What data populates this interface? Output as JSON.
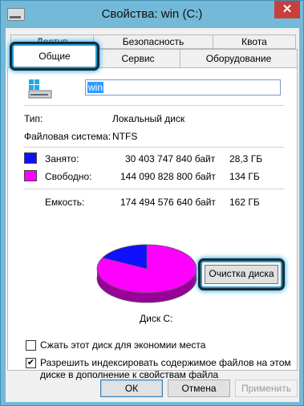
{
  "window": {
    "title": "Свойства: win (C:)",
    "close_symbol": "✕"
  },
  "tabs": {
    "row1": [
      "Доступ",
      "Безопасность",
      "Квота"
    ],
    "row2": [
      "Общие",
      "Сервис",
      "Оборудование"
    ]
  },
  "general": {
    "drive_name": "win",
    "type_label": "Тип:",
    "type_value": "Локальный диск",
    "fs_label": "Файловая система:",
    "fs_value": "NTFS",
    "used": {
      "label": "Занято:",
      "bytes": "30 403 747 840 байт",
      "size": "28,3 ГБ",
      "color": "#1010ff"
    },
    "free": {
      "label": "Свободно:",
      "bytes": "144 090 828 800 байт",
      "size": "134 ГБ",
      "color": "#ff00ff"
    },
    "capacity": {
      "label": "Емкость:",
      "bytes": "174 494 576 640 байт",
      "size": "162 ГБ"
    },
    "used_fraction": 0.174,
    "disk_label": "Диск C:",
    "cleanup_button": "Очистка диска",
    "compress_label": "Сжать этот диск для экономии места",
    "compress_checked": false,
    "index_label_line1": "Разрешить индексировать содержимое файлов на этом",
    "index_label_line2": "диске в дополнение к свойствам файла",
    "index_checked": true,
    "check_symbol": "✔"
  },
  "buttons": {
    "ok": "ОК",
    "cancel": "Отмена",
    "apply": "Применить"
  }
}
